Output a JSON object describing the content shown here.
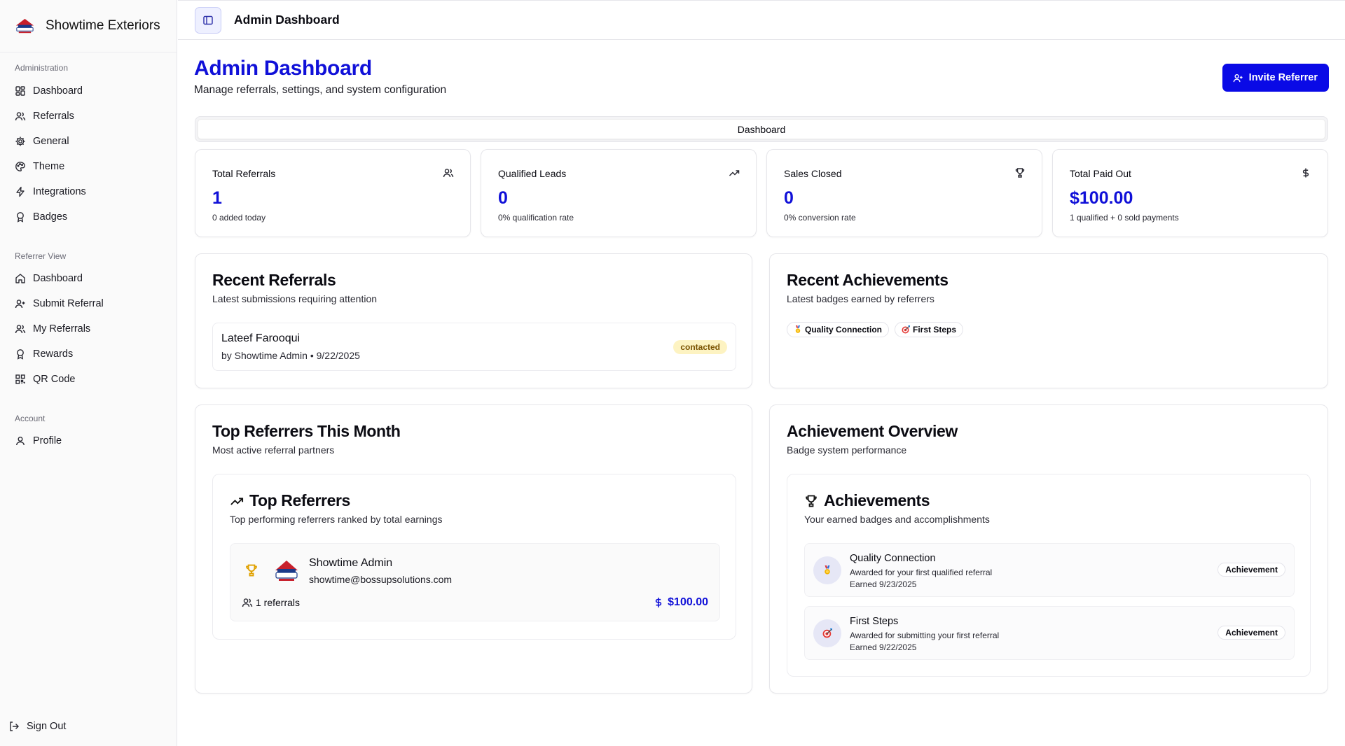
{
  "brand": {
    "name": "Showtime Exteriors"
  },
  "sidebar": {
    "groups": [
      {
        "label": "Administration",
        "items": [
          {
            "label": "Dashboard",
            "icon": "layout-grid-icon"
          },
          {
            "label": "Referrals",
            "icon": "users-icon"
          },
          {
            "label": "General",
            "icon": "gear-icon"
          },
          {
            "label": "Theme",
            "icon": "palette-icon"
          },
          {
            "label": "Integrations",
            "icon": "zap-icon"
          },
          {
            "label": "Badges",
            "icon": "award-icon"
          }
        ]
      },
      {
        "label": "Referrer View",
        "items": [
          {
            "label": "Dashboard",
            "icon": "home-icon"
          },
          {
            "label": "Submit Referral",
            "icon": "user-plus-icon"
          },
          {
            "label": "My Referrals",
            "icon": "users-icon"
          },
          {
            "label": "Rewards",
            "icon": "award-icon"
          },
          {
            "label": "QR Code",
            "icon": "qr-code-icon"
          }
        ]
      },
      {
        "label": "Account",
        "items": [
          {
            "label": "Profile",
            "icon": "user-icon"
          }
        ]
      }
    ],
    "sign_out": "Sign Out"
  },
  "topbar": {
    "title": "Admin Dashboard"
  },
  "header": {
    "title": "Admin Dashboard",
    "subtitle": "Manage referrals, settings, and system configuration",
    "invite_label": "Invite Referrer"
  },
  "tabs": [
    {
      "label": "Dashboard",
      "active": true
    }
  ],
  "stats": [
    {
      "label": "Total Referrals",
      "value": "1",
      "sub": "0 added today",
      "icon": "users-icon"
    },
    {
      "label": "Qualified Leads",
      "value": "0",
      "sub": "0% qualification rate",
      "icon": "trending-up-icon"
    },
    {
      "label": "Sales Closed",
      "value": "0",
      "sub": "0% conversion rate",
      "icon": "trophy-icon"
    },
    {
      "label": "Total Paid Out",
      "value": "$100.00",
      "sub": "1 qualified + 0 sold payments",
      "icon": "dollar-icon"
    }
  ],
  "recent_referrals": {
    "title": "Recent Referrals",
    "subtitle": "Latest submissions requiring attention",
    "items": [
      {
        "name": "Lateef Farooqui",
        "meta": "by Showtime Admin • 9/22/2025",
        "status": "contacted"
      }
    ]
  },
  "recent_achievements": {
    "title": "Recent Achievements",
    "subtitle": "Latest badges earned by referrers",
    "badges": [
      {
        "label": "Quality Connection",
        "icon": "medal-icon"
      },
      {
        "label": "First Steps",
        "icon": "target-icon"
      }
    ]
  },
  "top_referrers": {
    "title": "Top Referrers This Month",
    "subtitle": "Most active referral partners",
    "inner_title": "Top Referrers",
    "inner_subtitle": "Top performing referrers ranked by total earnings",
    "items": [
      {
        "name": "Showtime Admin",
        "email": "showtime@bossupsolutions.com",
        "referrals": "1 referrals",
        "amount": "$100.00"
      }
    ]
  },
  "achievement_overview": {
    "title": "Achievement Overview",
    "subtitle": "Badge system performance",
    "inner_title": "Achievements",
    "inner_subtitle": "Your earned badges and accomplishments",
    "items": [
      {
        "name": "Quality Connection",
        "desc": "Awarded for your first qualified referral",
        "date": "Earned 9/23/2025",
        "badge": "Achievement",
        "icon": "medal-icon"
      },
      {
        "name": "First Steps",
        "desc": "Awarded for submitting your first referral",
        "date": "Earned 9/22/2025",
        "badge": "Achievement",
        "icon": "target-icon"
      }
    ]
  },
  "colors": {
    "accent": "#1010d8",
    "button": "#0a0ae6",
    "status_contacted_bg": "#fdf3c2"
  }
}
